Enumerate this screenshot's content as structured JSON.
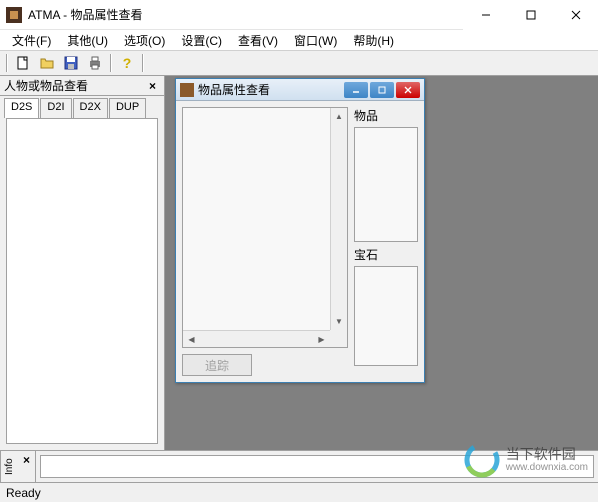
{
  "app": {
    "title": "ATMA - 物品属性查看"
  },
  "menubar": {
    "file": "文件(F)",
    "other": "其他(U)",
    "options": "选项(O)",
    "settings": "设置(C)",
    "view": "查看(V)",
    "window": "窗口(W)",
    "help": "帮助(H)"
  },
  "toolbar_icons": {
    "new": "new-icon",
    "open": "open-icon",
    "save": "save-icon",
    "print": "print-icon",
    "help": "help-icon"
  },
  "left_panel": {
    "title": "人物或物品查看",
    "tabs": [
      "D2S",
      "D2I",
      "D2X",
      "DUP"
    ]
  },
  "child_window": {
    "title": "物品属性查看",
    "item_label": "物品",
    "gem_label": "宝石",
    "track_button": "追踪"
  },
  "info_bar": {
    "label": "Info"
  },
  "status": {
    "text": "Ready"
  },
  "watermark": {
    "name": "当下软件园",
    "url": "www.downxia.com"
  }
}
